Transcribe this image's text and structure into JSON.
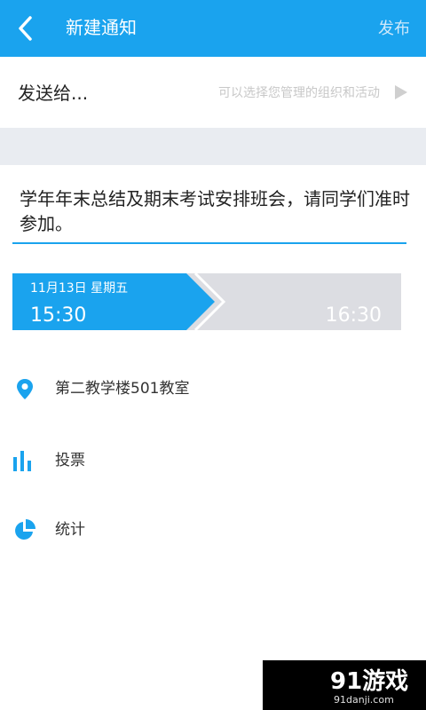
{
  "header": {
    "back_icon": "chevron-left-icon",
    "title": "新建通知",
    "publish_label": "发布",
    "background": "#1aa3ee"
  },
  "send_to": {
    "label": "发送给...",
    "hint": "可以选择您管理的组织和活动",
    "arrow_icon": "play-arrow-icon"
  },
  "message": {
    "text": "学年年末总结及期末考试安排班会，请同学们准时参加。"
  },
  "time": {
    "date_label": "11月13日  星期五",
    "start": "15:30",
    "end": "16:30",
    "active_color": "#1aa3ee",
    "inactive_color": "#dcdde2"
  },
  "options": [
    {
      "icon": "location-pin-icon",
      "label": "第二教学楼501教室"
    },
    {
      "icon": "bar-chart-icon",
      "label": "投票"
    },
    {
      "icon": "pie-chart-icon",
      "label": "统计"
    }
  ],
  "watermark": {
    "brand": "91游戏",
    "domain": "91danji.com"
  }
}
